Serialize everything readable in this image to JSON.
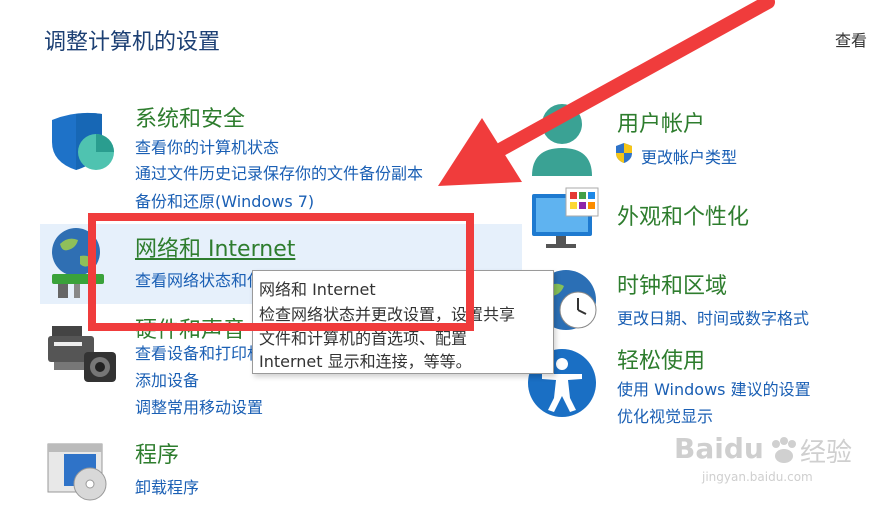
{
  "header": {
    "title": "调整计算机的设置",
    "view_by": "查看"
  },
  "left_categories": [
    {
      "title": "系统和安全",
      "links": [
        "查看你的计算机状态",
        "通过文件历史记录保存你的文件备份副本",
        "备份和还原(Windows 7)"
      ]
    },
    {
      "title": "网络和 Internet",
      "links": [
        "查看网络状态和任务"
      ]
    },
    {
      "title": "硬件和声音",
      "links": [
        "查看设备和打印机",
        "添加设备",
        "调整常用移动设置"
      ]
    },
    {
      "title": "程序",
      "links": [
        "卸载程序"
      ]
    }
  ],
  "right_categories": [
    {
      "title": "用户帐户",
      "links": [
        "更改帐户类型"
      ]
    },
    {
      "title": "外观和个性化",
      "links": []
    },
    {
      "title": "时钟和区域",
      "links": [
        "更改日期、时间或数字格式"
      ]
    },
    {
      "title": "轻松使用",
      "links": [
        "使用 Windows 建议的设置",
        "优化视觉显示"
      ]
    }
  ],
  "tooltip": {
    "line1": "网络和 Internet",
    "line2": "检查网络状态并更改设置，设置共享",
    "line3": "文件和计算机的首选项、配置",
    "line4": "Internet 显示和连接，等等。"
  },
  "watermark": {
    "brand": "Baidu",
    "chinese": "经验",
    "url": "jingyan.baidu.com"
  },
  "colors": {
    "category_green": "#2e7d2e",
    "link_blue": "#1a5fb4",
    "annotation_red": "#f03c3c",
    "hover_bg": "#e6f0fb"
  }
}
